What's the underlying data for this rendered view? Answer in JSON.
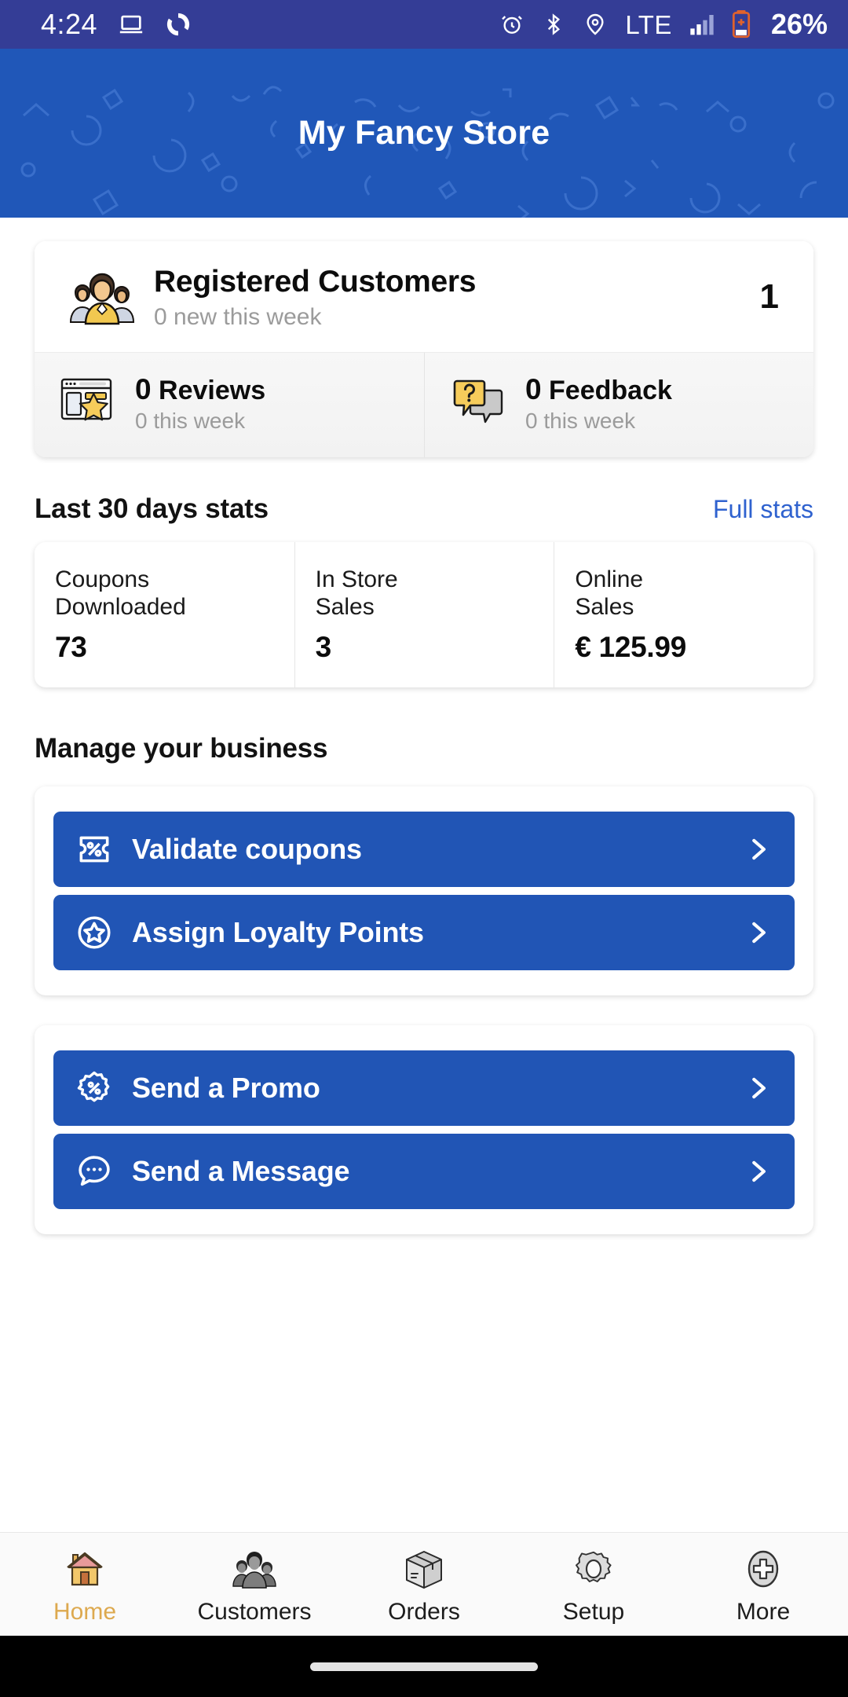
{
  "status_bar": {
    "time": "4:24",
    "battery_percent": "26%",
    "network": "LTE",
    "icons": [
      "laptop-icon",
      "sync-icon",
      "alarm-icon",
      "bluetooth-icon",
      "location-icon",
      "signal-icon",
      "battery-icon"
    ],
    "background_color": "#343d96"
  },
  "header": {
    "title": "My Fancy Store",
    "background_color": "#2057b8"
  },
  "customers_card": {
    "icon": "people-group-icon",
    "title": "Registered Customers",
    "subtitle": "0 new this week",
    "count": "1",
    "mini_stats": [
      {
        "icon": "review-page-star-icon",
        "count": "0",
        "label": "Reviews",
        "subtitle": "0 this week"
      },
      {
        "icon": "speech-bubbles-question-icon",
        "count": "0",
        "label": "Feedback",
        "subtitle": "0 this week"
      }
    ]
  },
  "stats_section": {
    "title": "Last 30 days stats",
    "link_label": "Full stats",
    "link_color": "#2f62cf",
    "cells": [
      {
        "label_line1": "Coupons",
        "label_line2": "Downloaded",
        "value": "73"
      },
      {
        "label_line1": "In Store",
        "label_line2": "Sales",
        "value": "3"
      },
      {
        "label_line1": "Online",
        "label_line2": "Sales",
        "value": "€ 125.99"
      }
    ]
  },
  "manage_section": {
    "title": "Manage your business",
    "accent_color": "#2155b5",
    "groups": [
      {
        "buttons": [
          {
            "icon": "coupon-ticket-percent-icon",
            "label": "Validate coupons",
            "chevron": "chevron-right-icon"
          },
          {
            "icon": "star-circle-icon",
            "label": "Assign Loyalty Points",
            "chevron": "chevron-right-icon"
          }
        ]
      },
      {
        "buttons": [
          {
            "icon": "promo-badge-percent-icon",
            "label": "Send a Promo",
            "chevron": "chevron-right-icon"
          },
          {
            "icon": "chat-bubble-dots-icon",
            "label": "Send a Message",
            "chevron": "chevron-right-icon"
          }
        ]
      }
    ]
  },
  "bottom_nav": {
    "active_color": "#dda94f",
    "items": [
      {
        "icon": "home-icon",
        "label": "Home",
        "active": true
      },
      {
        "icon": "customers-people-icon",
        "label": "Customers",
        "active": false
      },
      {
        "icon": "orders-box-icon",
        "label": "Orders",
        "active": false
      },
      {
        "icon": "setup-gear-icon",
        "label": "Setup",
        "active": false
      },
      {
        "icon": "more-plus-circle-icon",
        "label": "More",
        "active": false
      }
    ]
  },
  "system_nav": {
    "gesture_pill": "home-gesture-pill"
  }
}
